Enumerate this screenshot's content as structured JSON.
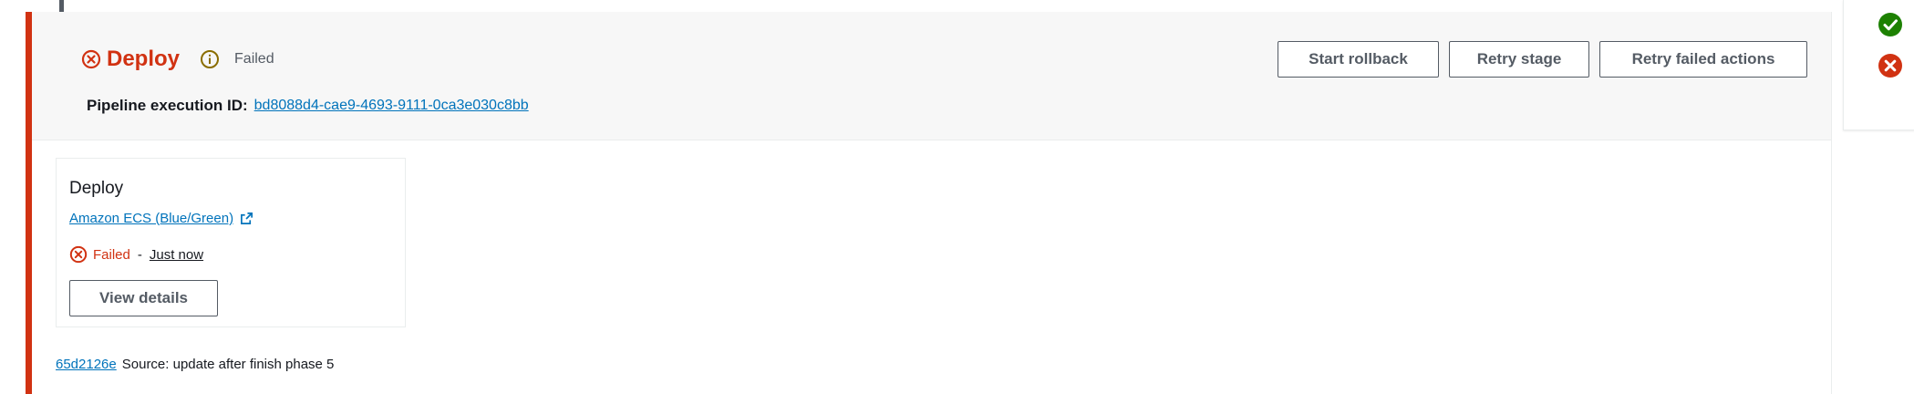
{
  "stage": {
    "name": "Deploy",
    "status": "Failed",
    "execution_label": "Pipeline execution ID:",
    "execution_id": "bd8088d4-cae9-4693-9111-0ca3e030c8bb",
    "status_icon": "failed-x-icon",
    "info_icon": "info-icon",
    "actions": {
      "start_rollback": "Start rollback",
      "retry_stage": "Retry stage",
      "retry_failed_actions": "Retry failed actions"
    }
  },
  "action": {
    "name": "Deploy",
    "provider": "Amazon ECS (Blue/Green)",
    "provider_icon": "external-link-icon",
    "status": "Failed",
    "separator": "-",
    "time": "Just now",
    "view_details": "View details"
  },
  "revision": {
    "id": "65d2126e",
    "summary": "Source: update after finish phase 5"
  },
  "legend": {
    "icons": [
      "success-check-icon",
      "failed-x-icon"
    ]
  },
  "colors": {
    "failed": "#d13212",
    "success": "#1d8102",
    "link": "#0073bb",
    "button_border": "#545b64",
    "header_bg": "#f7f7f7"
  }
}
